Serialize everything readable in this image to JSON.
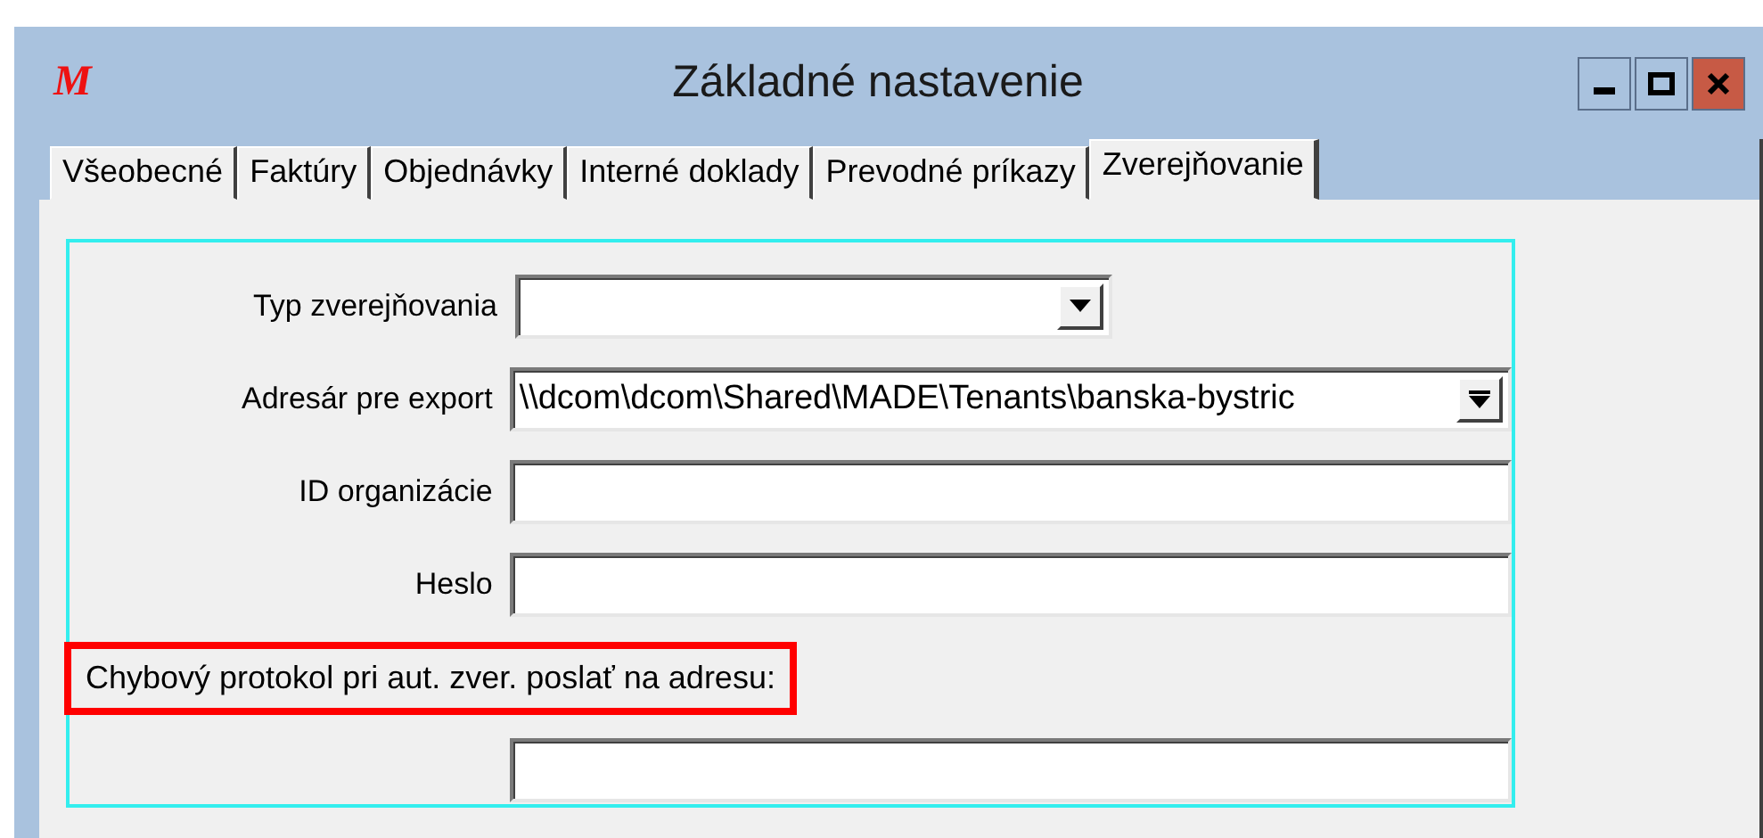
{
  "window": {
    "logo": "M",
    "title": "Základné nastavenie"
  },
  "tabs": [
    {
      "label": "Všeobecné",
      "selected": false
    },
    {
      "label": "Faktúry",
      "selected": false
    },
    {
      "label": "Objednávky",
      "selected": false
    },
    {
      "label": "Interné doklady",
      "selected": false
    },
    {
      "label": "Prevodné príkazy",
      "selected": false
    },
    {
      "label": "Zverejňovanie",
      "selected": true
    }
  ],
  "fields": [
    {
      "kind": "list",
      "label": "Typ zverejňovania"
    },
    {
      "kind": "path",
      "label": "Adresár pre export",
      "value": "\\\\dcom\\dcom\\Shared\\MADE\\Tenants\\banska-bystric"
    },
    {
      "kind": "text",
      "label": "ID organizácie"
    },
    {
      "kind": "text",
      "label": "Heslo"
    },
    {
      "kind": "caption",
      "label": "Chybový protokol pri aut. zver. poslať na adresu:",
      "highlighted": true
    },
    {
      "kind": "text"
    }
  ]
}
